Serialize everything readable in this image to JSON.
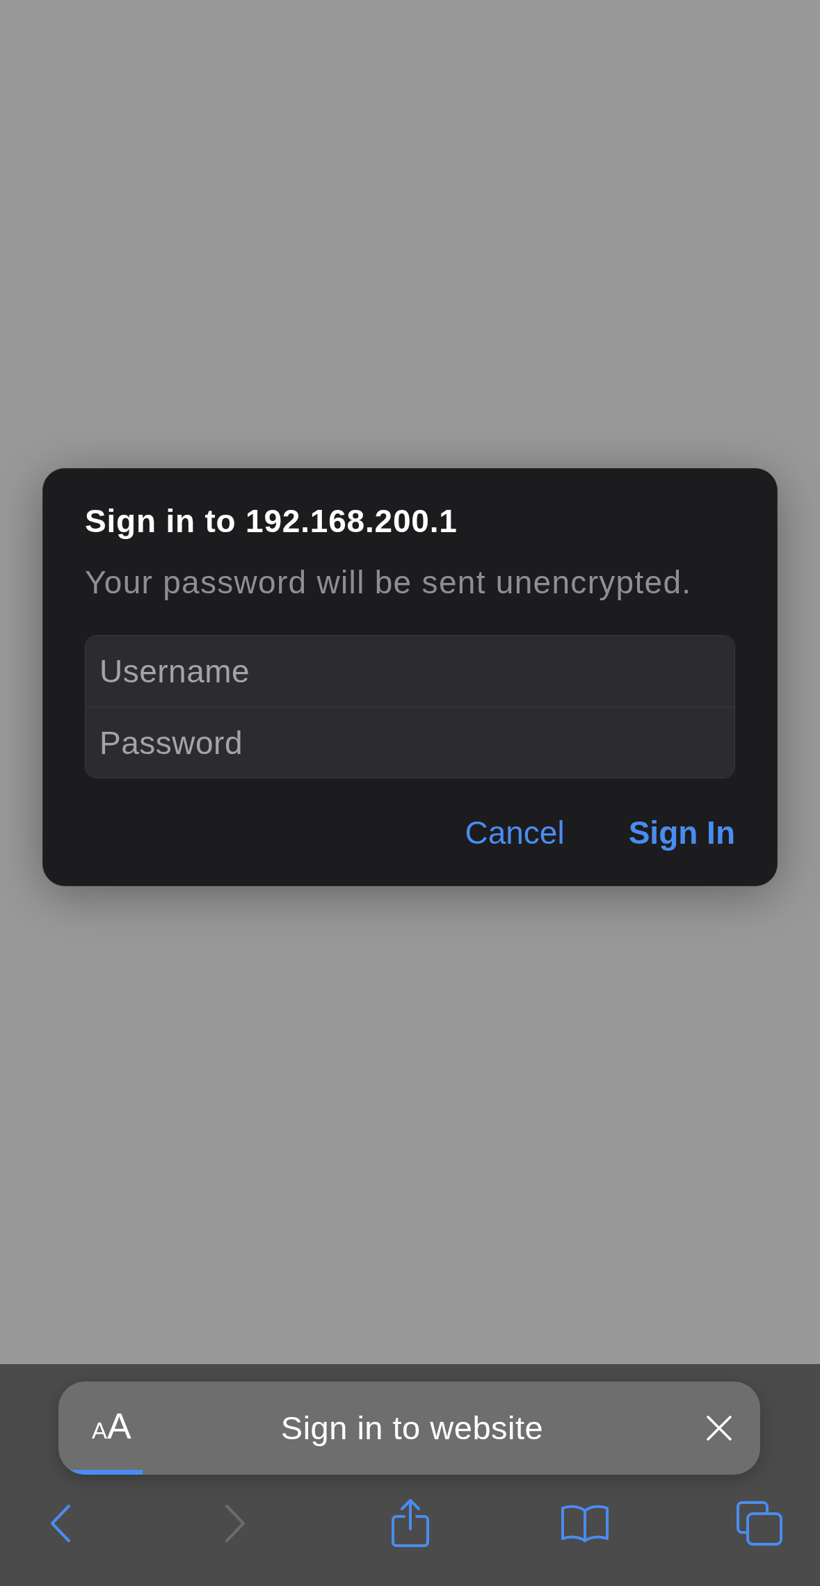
{
  "dialog": {
    "title": "Sign in to 192.168.200.1",
    "message": "Your password will be sent unencrypted.",
    "fields": [
      {
        "placeholder": "Username"
      },
      {
        "placeholder": "Password"
      }
    ],
    "buttons": [
      {
        "label": "Cancel",
        "kind": "cancel"
      },
      {
        "label": "Sign In",
        "kind": "default"
      }
    ]
  },
  "banner": {
    "text_size_letters": [
      "A",
      "A"
    ],
    "title": "Sign in to website",
    "progress": {
      "level": 0.12
    }
  },
  "toolbar": [
    {
      "kind": "back",
      "disabled": false
    },
    {
      "kind": "forward",
      "disabled": true
    },
    {
      "kind": "share",
      "disabled": false
    },
    {
      "kind": "bookmarks",
      "disabled": false
    },
    {
      "kind": "tabs",
      "disabled": false
    }
  ]
}
